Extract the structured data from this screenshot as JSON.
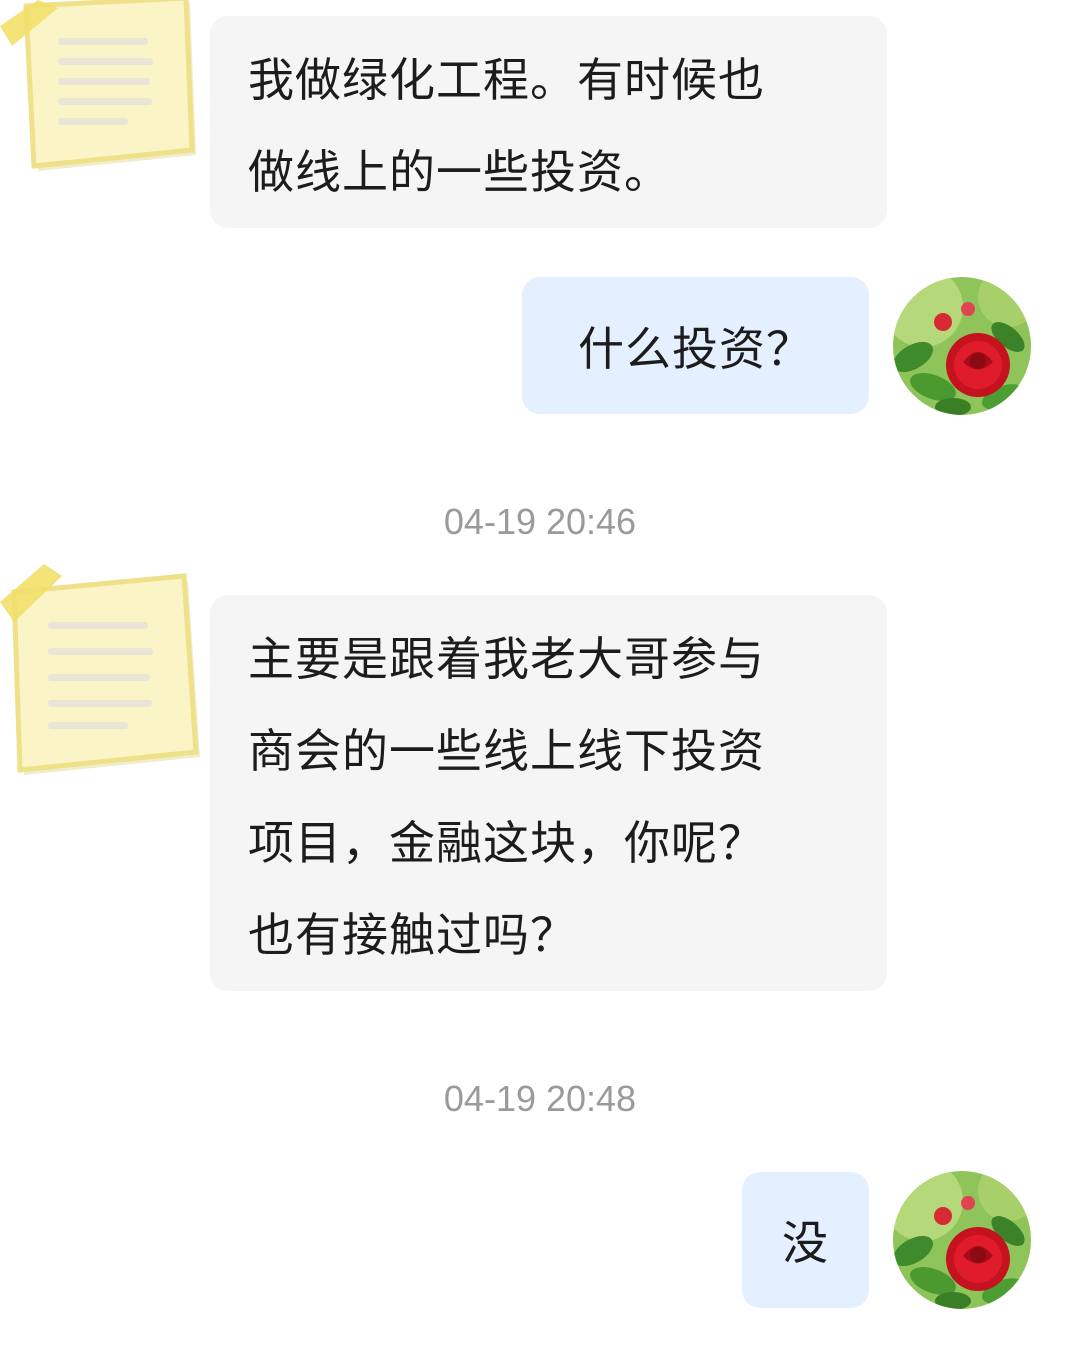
{
  "conversation": {
    "messages": [
      {
        "id": "msg-1",
        "direction": "incoming",
        "text": "我做绿化工程。有时候也\n做线上的一些投资。"
      },
      {
        "id": "msg-2",
        "direction": "outgoing",
        "text": "什么投资？"
      },
      {
        "id": "msg-3",
        "direction": "incoming",
        "text": "主要是跟着我老大哥参与\n商会的一些线上线下投资\n项目，金融这块，你呢？\n也有接触过吗？"
      },
      {
        "id": "msg-4",
        "direction": "outgoing",
        "text": "没"
      }
    ],
    "timestamps": [
      "04-19 20:46",
      "04-19 20:48"
    ]
  },
  "avatars": {
    "contact": {
      "icon": "sticky-note-icon",
      "note_color": "#fbf3c0",
      "tape_color": "#f4e27a"
    },
    "self": {
      "icon": "red-rose-photo",
      "flower_color": "#e01c2c",
      "leaf_color": "#4e9a2c"
    }
  },
  "colors": {
    "incoming_bubble": "#f5f5f5",
    "outgoing_bubble": "#e4f0ff",
    "timestamp_text": "#9a9a9a"
  }
}
